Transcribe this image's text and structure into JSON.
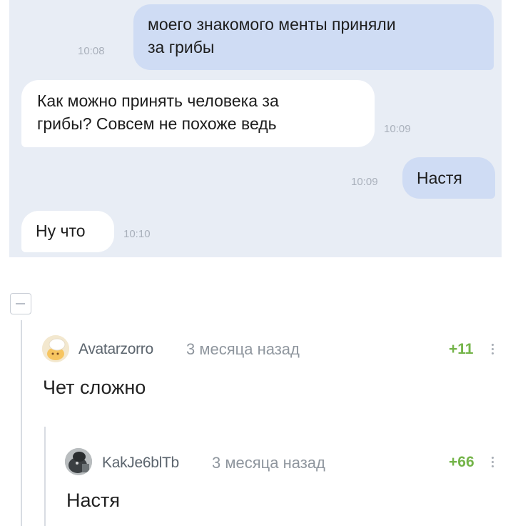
{
  "chat": {
    "messages": [
      {
        "text_line1": "моего знакомого менты приняли",
        "text_line2": "за грибы",
        "time": "10:08",
        "side": "outgoing"
      },
      {
        "text_line1": "Как можно принять человека за",
        "text_line2": "грибы? Совсем не похоже ведь",
        "time": "10:09",
        "side": "incoming"
      },
      {
        "text_line1": "Настя",
        "time": "10:09",
        "side": "outgoing"
      },
      {
        "text_line1": "Ну что",
        "time": "10:10",
        "side": "incoming"
      }
    ]
  },
  "comments": [
    {
      "username": "Avatarzorro",
      "ago": "3 месяца назад",
      "rating": "+11",
      "text": "Чет сложно"
    },
    {
      "username": "KakJe6blTb",
      "ago": "3 месяца назад",
      "rating": "+66",
      "text": "Настя"
    }
  ],
  "colors": {
    "chat_background": "#e8edf5",
    "outgoing_bubble": "#cfdcf4",
    "incoming_bubble": "#ffffff",
    "rating_positive": "#74b449"
  }
}
